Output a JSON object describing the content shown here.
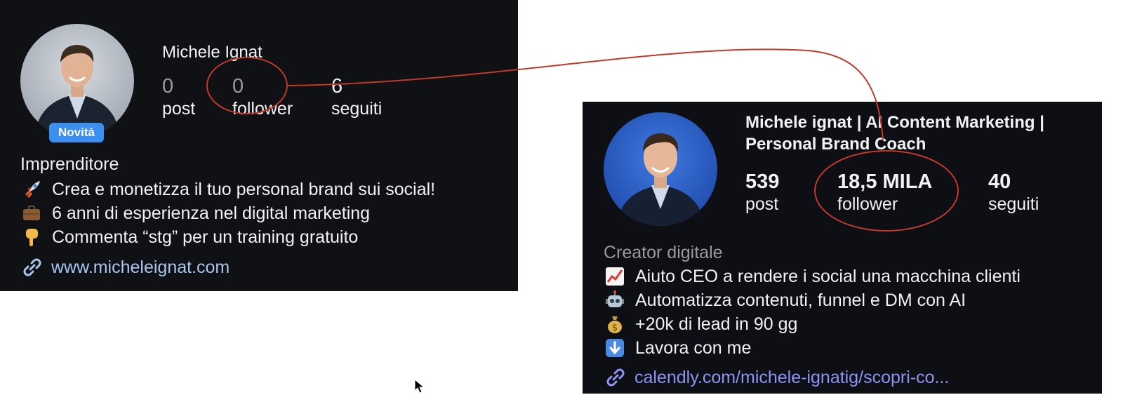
{
  "left_profile": {
    "name": "Michele Ignat",
    "badge": "Novità",
    "stats": [
      {
        "value": "0",
        "label": "post"
      },
      {
        "value": "0",
        "label": "follower"
      },
      {
        "value": "6",
        "label": "seguiti"
      }
    ],
    "category": "Imprenditore",
    "bio": [
      {
        "icon": "rocket-icon",
        "text": "Crea e monetizza il tuo personal brand sui social!"
      },
      {
        "icon": "briefcase-icon",
        "text": "6 anni di esperienza nel digital marketing"
      },
      {
        "icon": "pointing-down-hand-icon",
        "text": "Commenta “stg” per un training gratuito"
      }
    ],
    "link": "www.micheleignat.com"
  },
  "right_profile": {
    "name": "Michele ignat | AI Content Marketing | Personal Brand Coach",
    "stats": [
      {
        "value": "539",
        "label": "post"
      },
      {
        "value": "18,5 MILA",
        "label": "follower"
      },
      {
        "value": "40",
        "label": "seguiti"
      }
    ],
    "category": "Creator digitale",
    "bio": [
      {
        "icon": "chart-increasing-icon",
        "text": "Aiuto CEO a rendere i social una macchina clienti"
      },
      {
        "icon": "robot-icon",
        "text": "Automatizza contenuti, funnel e DM con AI"
      },
      {
        "icon": "money-bag-icon",
        "text": "+20k di lead in 90 gg"
      },
      {
        "icon": "down-arrow-icon",
        "text": "Lavora con me"
      }
    ],
    "link": "calendly.com/michele-ignatig/scopri-co..."
  },
  "colors": {
    "card_background": "#0f1115",
    "badge": "#3a8ff0",
    "left_link": "#a8c6ee",
    "right_link": "#8f94f3",
    "annotation_red": "#c0392b"
  }
}
